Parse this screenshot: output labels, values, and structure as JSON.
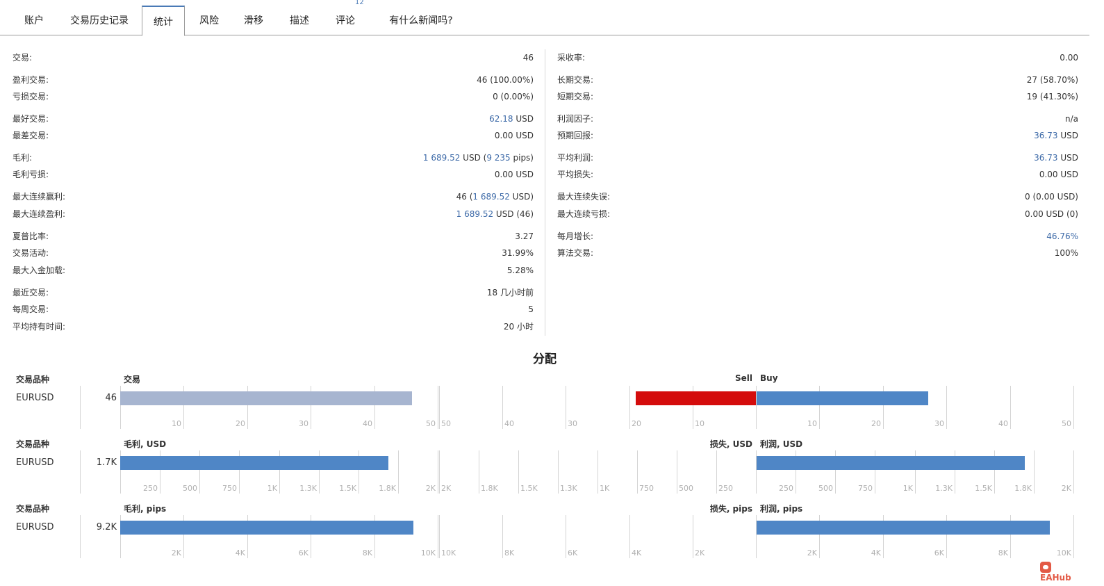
{
  "tabs": [
    {
      "label": "账户"
    },
    {
      "label": "交易历史记录"
    },
    {
      "label": "统计"
    },
    {
      "label": "风险"
    },
    {
      "label": "滑移"
    },
    {
      "label": "描述"
    },
    {
      "label": "评论",
      "badge": "12"
    },
    {
      "label": "有什么新闻吗?"
    }
  ],
  "active_tab": "统计",
  "stats_left": [
    {
      "label": "交易:",
      "value": "46"
    },
    {
      "label": "盈利交易:",
      "value": "46 (100.00%)"
    },
    {
      "label": "亏损交易:",
      "value": "0 (0.00%)"
    },
    {
      "label": "最好交易:",
      "value_blue": "62.18",
      "value_rest": " USD"
    },
    {
      "label": "最差交易:",
      "value": "0.00 USD"
    },
    {
      "label": "毛利:",
      "value_blue": "1 689.52",
      "value_mid": " USD (",
      "value_blue2": "9 235",
      "value_rest": " pips)"
    },
    {
      "label": "毛利亏损:",
      "value": "0.00 USD"
    },
    {
      "label": "最大连续赢利:",
      "value_pre": "46 (",
      "value_blue": "1 689.52",
      "value_rest": " USD)"
    },
    {
      "label": "最大连续盈利:",
      "value_blue": "1 689.52",
      "value_rest": " USD (46)"
    },
    {
      "label": "夏普比率:",
      "value": "3.27"
    },
    {
      "label": "交易活动:",
      "value": "31.99%"
    },
    {
      "label": "最大入金加载:",
      "value": "5.28%"
    },
    {
      "label": "最近交易:",
      "value": "18 几小时前"
    },
    {
      "label": "每周交易:",
      "value": "5"
    },
    {
      "label": "平均持有时间:",
      "value": "20 小时"
    }
  ],
  "stats_right": [
    {
      "label": "采收率:",
      "value": "0.00"
    },
    {
      "label": "长期交易:",
      "value": "27 (58.70%)"
    },
    {
      "label": "短期交易:",
      "value": "19 (41.30%)"
    },
    {
      "label": "利润因子:",
      "value": "n/a"
    },
    {
      "label": "预期回报:",
      "value_blue": "36.73",
      "value_rest": " USD"
    },
    {
      "label": "平均利润:",
      "value_blue": "36.73",
      "value_rest": " USD"
    },
    {
      "label": "平均损失:",
      "value": "0.00 USD"
    },
    {
      "label": "最大连续失误:",
      "value": "0 (0.00 USD)"
    },
    {
      "label": "最大连续亏损:",
      "value": "0.00 USD (0)"
    },
    {
      "label": "每月增长:",
      "value_blue": "46.76%"
    },
    {
      "label": "算法交易:",
      "value": "100%"
    }
  ],
  "distribution": {
    "title": "分配",
    "panels": [
      {
        "symbol_header": "交易品种",
        "symbol": "EURUSD",
        "left_header": "交易",
        "total_label": "46",
        "sell_header": "Sell",
        "buy_header": "Buy",
        "left_value": 46,
        "left_max": 50,
        "left_ticks": [
          "10",
          "20",
          "30",
          "40",
          "50"
        ],
        "sell_value": 19,
        "buy_value": 27,
        "side_max": 50,
        "sell_ticks": [
          "50",
          "40",
          "30",
          "20",
          "10"
        ],
        "buy_ticks": [
          "10",
          "20",
          "30",
          "40",
          "50"
        ],
        "left_color": "#a7b5d0",
        "sell_color": "#d40c0c",
        "buy_color": "#4f86c6"
      },
      {
        "symbol_header": "交易品种",
        "symbol": "EURUSD",
        "left_header": "毛利, USD",
        "total_label": "1.7K",
        "sell_header": "损失, USD",
        "buy_header": "利润, USD",
        "left_value": 1689.52,
        "left_max": 2000,
        "left_ticks": [
          "250",
          "500",
          "750",
          "1K",
          "1.3K",
          "1.5K",
          "1.8K",
          "2K"
        ],
        "sell_value": 0,
        "buy_value": 1689.52,
        "side_max": 2000,
        "sell_ticks": [
          "2K",
          "1.8K",
          "1.5K",
          "1.3K",
          "1K",
          "750",
          "500",
          "250"
        ],
        "buy_ticks": [
          "250",
          "500",
          "750",
          "1K",
          "1.3K",
          "1.5K",
          "1.8K",
          "2K"
        ],
        "left_color": "#4f86c6",
        "sell_color": "#d40c0c",
        "buy_color": "#4f86c6"
      },
      {
        "symbol_header": "交易品种",
        "symbol": "EURUSD",
        "left_header": "毛利, pips",
        "total_label": "9.2K",
        "sell_header": "损失, pips",
        "buy_header": "利润, pips",
        "left_value": 9235,
        "left_max": 10000,
        "left_ticks": [
          "2K",
          "4K",
          "6K",
          "8K",
          "10K"
        ],
        "sell_value": 0,
        "buy_value": 9235,
        "side_max": 10000,
        "sell_ticks": [
          "10K",
          "8K",
          "6K",
          "4K",
          "2K"
        ],
        "buy_ticks": [
          "2K",
          "4K",
          "6K",
          "8K",
          "10K"
        ],
        "left_color": "#4f86c6",
        "sell_color": "#d40c0c",
        "buy_color": "#4f86c6"
      }
    ]
  },
  "watermark": {
    "text": "EAHub",
    "icon": "eahub-logo-icon"
  }
}
